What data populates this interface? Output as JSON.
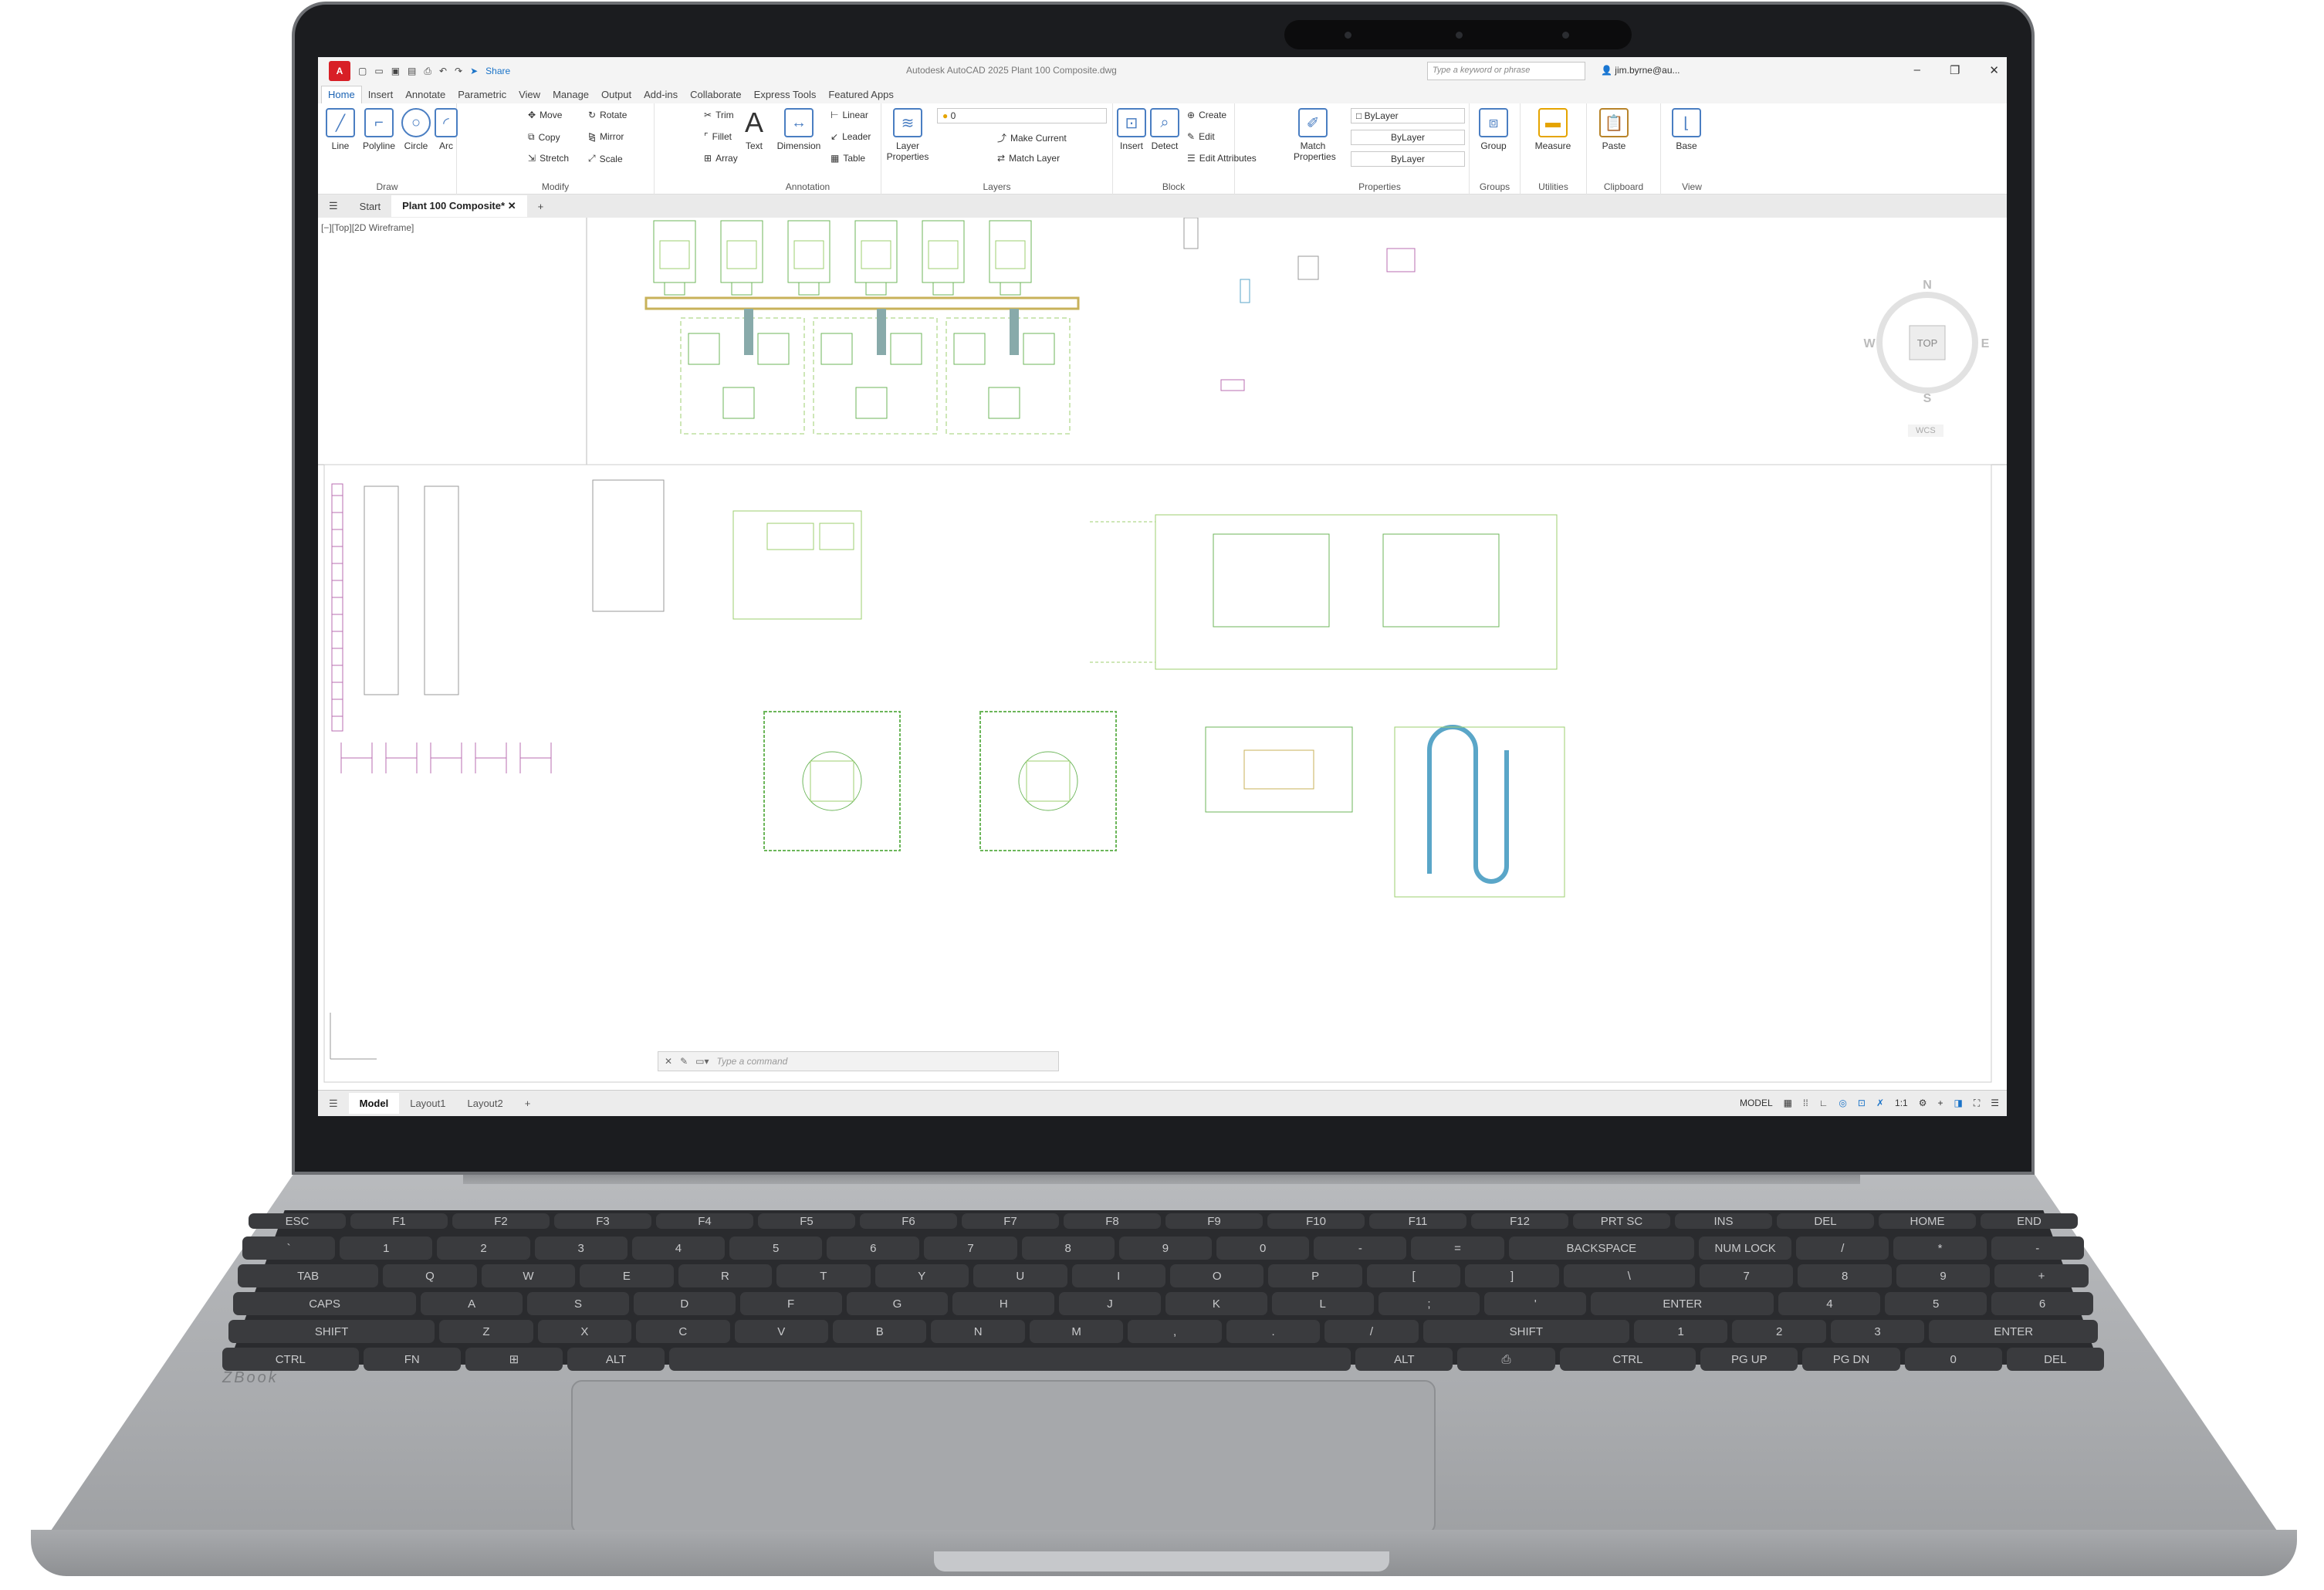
{
  "app": {
    "logo_letter": "A",
    "share_label": "Share",
    "title": "Autodesk AutoCAD 2025   Plant 100 Composite.dwg",
    "search_placeholder": "Type a keyword or phrase",
    "user": "jim.byrne@au...",
    "ribbon_tabs": [
      "Home",
      "Insert",
      "Annotate",
      "Parametric",
      "View",
      "Manage",
      "Output",
      "Add-ins",
      "Collaborate",
      "Express Tools",
      "Featured Apps"
    ]
  },
  "ribbon": {
    "draw": {
      "label": "Draw",
      "line": "Line",
      "polyline": "Polyline",
      "circle": "Circle",
      "arc": "Arc"
    },
    "modify": {
      "label": "Modify",
      "move": "Move",
      "rotate": "Rotate",
      "trim": "Trim",
      "copy": "Copy",
      "mirror": "Mirror",
      "fillet": "Fillet",
      "stretch": "Stretch",
      "scale": "Scale",
      "array": "Array"
    },
    "annotation": {
      "label": "Annotation",
      "text": "Text",
      "dimension": "Dimension",
      "linear": "Linear",
      "leader": "Leader",
      "table": "Table"
    },
    "layers": {
      "label": "Layers",
      "layer_properties": "Layer Properties",
      "layer_value": "0",
      "make_current": "Make Current",
      "match_layer": "Match Layer"
    },
    "block": {
      "label": "Block",
      "insert": "Insert",
      "detect": "Detect",
      "create": "Create",
      "edit": "Edit",
      "edit_attributes": "Edit Attributes"
    },
    "properties": {
      "label": "Properties",
      "match_properties": "Match Properties",
      "color": "ByLayer",
      "linetype": "ByLayer",
      "lineweight": "ByLayer"
    },
    "groups": {
      "label": "Groups",
      "group": "Group"
    },
    "utilities": {
      "label": "Utilities",
      "measure": "Measure"
    },
    "clipboard": {
      "label": "Clipboard",
      "paste": "Paste"
    },
    "view": {
      "label": "View",
      "base": "Base"
    }
  },
  "file_tabs": [
    "Start",
    "Plant 100 Composite*"
  ],
  "viewport_label": "[−][Top][2D Wireframe]",
  "viewcube": {
    "top": "TOP",
    "n": "N",
    "s": "S",
    "e": "E",
    "w": "W",
    "wcs": "WCS"
  },
  "command_placeholder": "Type a command",
  "layout_tabs": [
    "Model",
    "Layout1",
    "Layout2"
  ],
  "status": {
    "mode": "MODEL",
    "scale": "1:1"
  },
  "keyboard": {
    "rows": [
      [
        "esc",
        "f1",
        "f2",
        "f3",
        "f4",
        "f5",
        "f6",
        "f7",
        "f8",
        "f9",
        "f10",
        "f11",
        "f12",
        "prt sc",
        "ins",
        "del",
        "home",
        "end"
      ],
      [
        "`",
        "1",
        "2",
        "3",
        "4",
        "5",
        "6",
        "7",
        "8",
        "9",
        "0",
        "-",
        "=",
        "backspace",
        "num lock",
        "/",
        "*",
        "-"
      ],
      [
        "tab",
        "q",
        "w",
        "e",
        "r",
        "t",
        "y",
        "u",
        "i",
        "o",
        "p",
        "[",
        "]",
        "\\",
        "7",
        "8",
        "9",
        "+"
      ],
      [
        "caps",
        "a",
        "s",
        "d",
        "f",
        "g",
        "h",
        "j",
        "k",
        "l",
        ";",
        "'",
        "enter",
        "4",
        "5",
        "6"
      ],
      [
        "shift",
        "z",
        "x",
        "c",
        "v",
        "b",
        "n",
        "m",
        ",",
        ".",
        "/",
        "shift",
        "1",
        "2",
        "3",
        "enter"
      ],
      [
        "ctrl",
        "fn",
        "⊞",
        "alt",
        "",
        "alt",
        "⎙",
        "ctrl",
        "pg up",
        "pg dn",
        "0",
        "del"
      ]
    ],
    "brand": "ZBook"
  }
}
